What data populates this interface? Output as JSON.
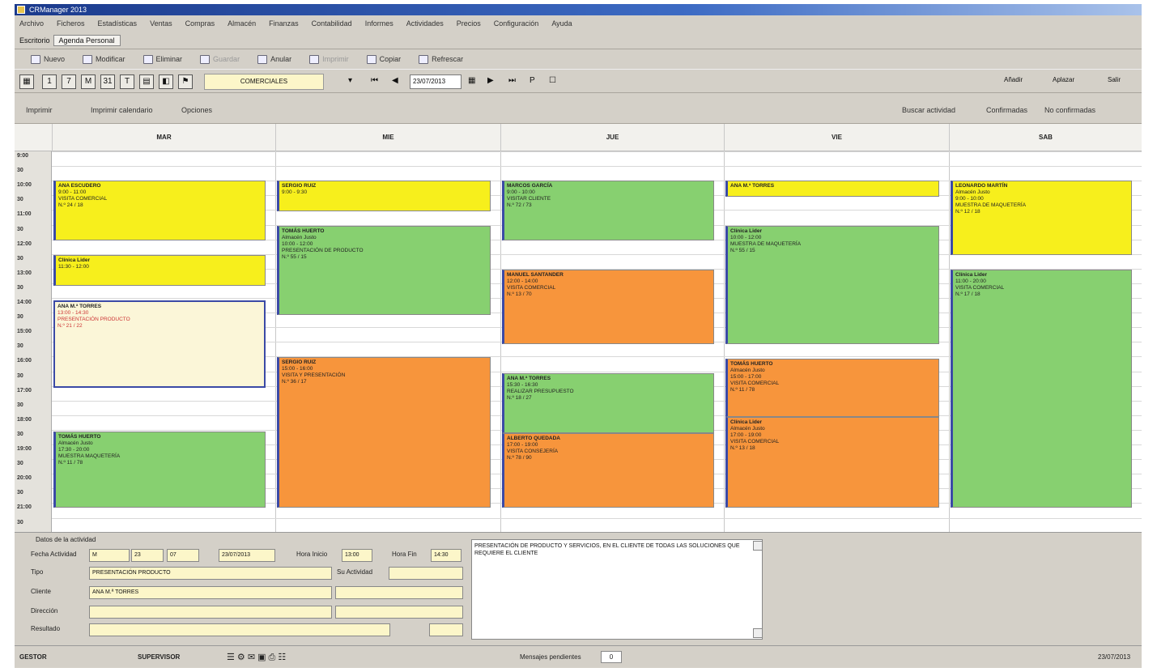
{
  "app": {
    "title": "CRManager 2013"
  },
  "menu": [
    "Archivo",
    "Ficheros",
    "Estadísticas",
    "Ventas",
    "Compras",
    "Almacén",
    "Finanzas",
    "Contabilidad",
    "Informes",
    "Actividades",
    "Precios",
    "Configuración",
    "Ayuda"
  ],
  "tabrow": {
    "label": "Escritorio",
    "tab": "Agenda Personal"
  },
  "toolbar1": {
    "nuevo": "Nuevo",
    "modificar": "Modificar",
    "eliminar": "Eliminar",
    "guardar": "Guardar",
    "anular": "Anular",
    "imprimir": "Imprimir",
    "copiar": "Copiar",
    "refrescar": "Refrescar"
  },
  "toolbar2": {
    "views": [
      "1",
      "7",
      "M",
      "31",
      "T"
    ],
    "combo": "COMERCIALES",
    "date": "23/07/2013",
    "right": [
      "Añadir",
      "Aplazar",
      "Salir"
    ]
  },
  "toolbar3": {
    "left": [
      "Imprimir",
      "Imprimir calendario",
      "Opciones"
    ],
    "right": [
      "Buscar actividad",
      "Confirmadas",
      "No confirmadas"
    ]
  },
  "days": [
    "MAR",
    "MIE",
    "JUE",
    "VIE",
    "SAB"
  ],
  "times": [
    "9:00",
    "30",
    "10:00",
    "30",
    "11:00",
    "30",
    "12:00",
    "30",
    "13:00",
    "30",
    "14:00",
    "30",
    "15:00",
    "30",
    "16:00",
    "30",
    "17:00",
    "30",
    "18:00",
    "30",
    "19:00",
    "30",
    "20:00",
    "30",
    "21:00",
    "30"
  ],
  "events": [
    {
      "day": 0,
      "color": "y",
      "title": "ANA ESCUDERO",
      "body": "9:00 - 11:00\nVISITA COMERCIAL\nN.º 24 / 18"
    },
    {
      "day": 0,
      "color": "y",
      "title": "Clínica Lider",
      "body": "11:30 - 12:00"
    },
    {
      "day": 0,
      "color": "c",
      "title": "ANA M.ª TORRES",
      "body": "13:00 - 14:30\nPRESENTACIÓN PRODUCTO\nN.º 21 / 22"
    },
    {
      "day": 0,
      "color": "g",
      "title": "TOMÁS HUERTO",
      "body": "Almacén Justo\n17:30 - 20:00\nMUESTRA MAQUETERÍA\nN.º 11 / 78"
    },
    {
      "day": 1,
      "color": "y",
      "title": "SERGIO RUIZ",
      "body": "9:00 - 9:30"
    },
    {
      "day": 1,
      "color": "g",
      "title": "TOMÁS HUERTO",
      "body": "Almacén Justo\n10:00 - 12:00\nPRESENTACIÓN DE PRODUCTO\nN.º 55 / 15"
    },
    {
      "day": 1,
      "color": "o",
      "title": "SERGIO RUIZ",
      "body": "15:00 - 16:00\nVISITA Y PRESENTACIÓN\nN.º 36 / 17"
    },
    {
      "day": 2,
      "color": "g",
      "title": "MARCOS GARCÍA",
      "body": "9:00 - 10:00\nVISITAR CLIENTE\nN.º 72 / 73"
    },
    {
      "day": 2,
      "color": "o",
      "title": "MANUEL SANTANDER",
      "body": "12:00 - 14:00\nVISITA COMERCIAL\nN.º 13 / 70"
    },
    {
      "day": 2,
      "color": "g",
      "title": "ANA M.ª TORRES",
      "body": "15:30 - 16:30\nREALIZAR PRESUPUESTO\nN.º 18 / 27"
    },
    {
      "day": 2,
      "color": "o",
      "title": "ALBERTO QUEDADA",
      "body": "17:00 - 19:00\nVISITA CONSEJERÍA\nN.º 78 / 90"
    },
    {
      "day": 3,
      "color": "y",
      "title": "ANA M.ª TORRES",
      "body": ""
    },
    {
      "day": 3,
      "color": "g",
      "title": "Clínica Lider",
      "body": "10:00 - 12:00\nMUESTRA DE MAQUETERÍA\nN.º 55 / 15"
    },
    {
      "day": 3,
      "color": "o",
      "title": "TOMÁS HUERTO",
      "body": "Almacén Justo\n15:00 - 17:00\nVISITA COMERCIAL\nN.º 11 / 78"
    },
    {
      "day": 3,
      "color": "o",
      "title": "Clínica Lider",
      "body": "Almacén Justo\n17:00 - 19:00\nVISITA COMERCIAL\nN.º 13 / 18"
    },
    {
      "day": 4,
      "color": "y",
      "title": "LEONARDO MARTÍN",
      "body": "Almacén Justo\n9:00 - 10:00\nMUESTRA DE MAQUETERÍA\nN.º 12 / 18"
    },
    {
      "day": 4,
      "color": "g",
      "title": "Clínica Lider",
      "body": "11:00 - 20:00\nVISITA COMERCIAL\nN.º 17 / 18"
    }
  ],
  "detail": {
    "section": "Datos de la actividad",
    "fecha_label": "Fecha Actividad",
    "fecha": [
      "M",
      "23",
      "07",
      "23/07/2013"
    ],
    "inicio_label": "Hora Inicio",
    "inicio": "13:00",
    "fin_label": "Hora Fin",
    "fin": "14:30",
    "tipo_label": "Tipo",
    "tipo": "PRESENTACIÓN PRODUCTO",
    "cliente_label": "Cliente",
    "cliente": "ANA M.ª TORRES",
    "direccion_label": "Dirección",
    "resultado_label": "Resultado",
    "estado_label": "Su Actividad",
    "notes": "PRESENTACIÓN DE PRODUCTO Y SERVICIOS, EN EL CLIENTE DE TODAS LAS SOLUCIONES QUE REQUIERE EL CLIENTE"
  },
  "status": {
    "user": "GESTOR",
    "db": "SUPERVISOR",
    "msg_label": "Mensajes pendientes",
    "msg_count": "0",
    "date": "23/07/2013"
  }
}
